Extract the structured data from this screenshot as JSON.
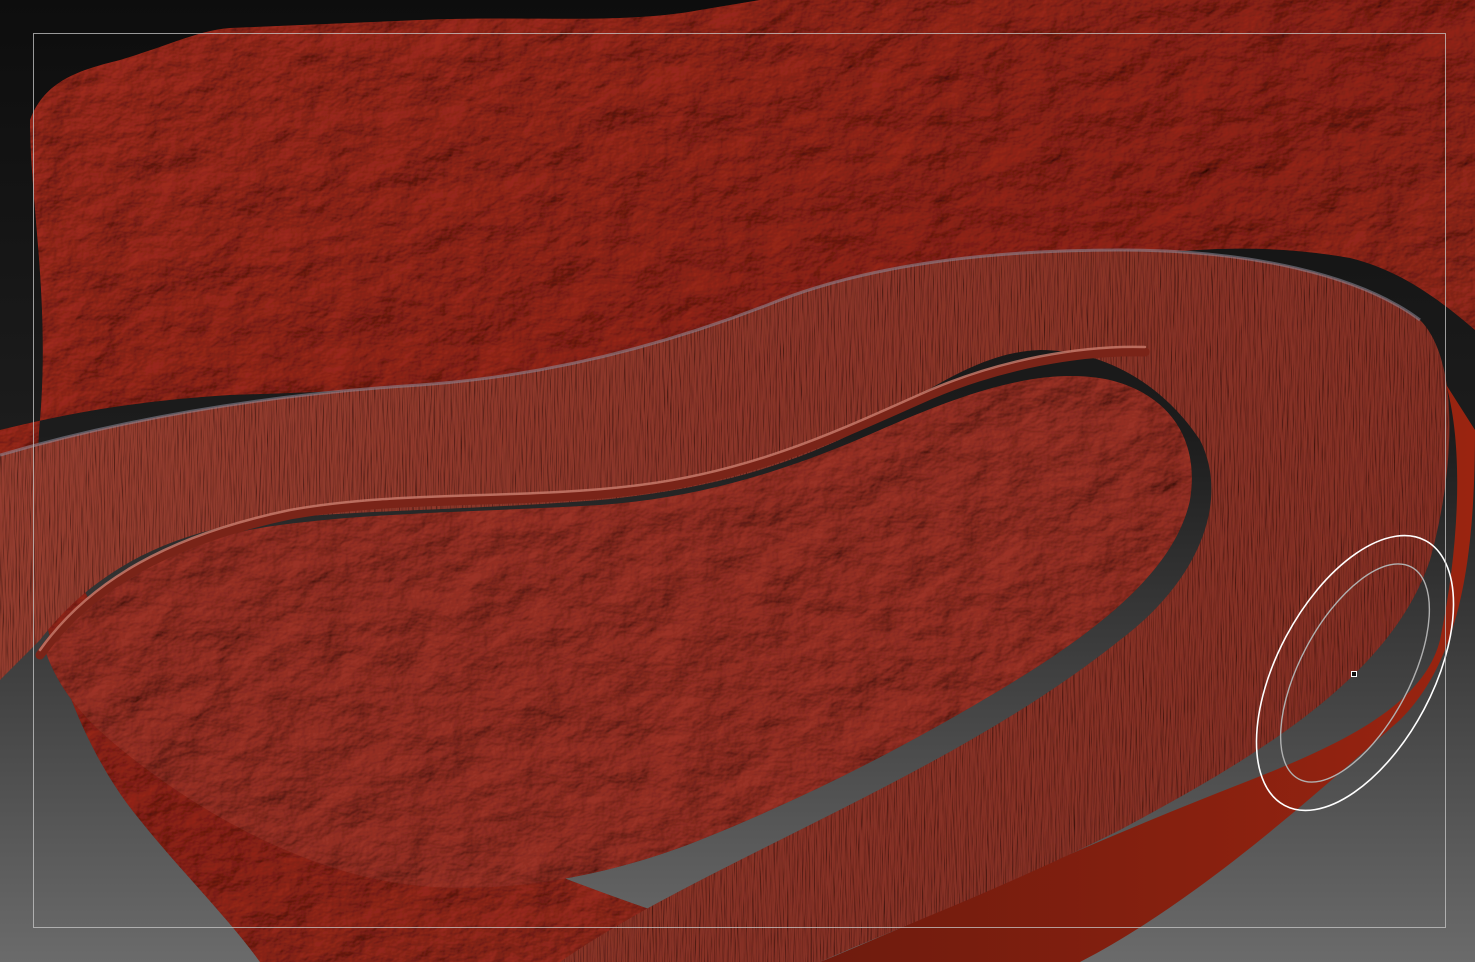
{
  "viewport": {
    "background_top": "#0d0d0d",
    "background_bottom": "#6b6b6b",
    "mesh_color": "#a8463d",
    "mesh_shadow": "#5c1a12",
    "mesh_highlight": "#d79483",
    "road_color": "#a65a50",
    "rim_color": "#8a1f0f",
    "frame_color": "#c8c8c8",
    "brush_ring_color": "#ffffff"
  },
  "scene": {
    "terrain": "terrain-mesh",
    "road": "road-surface",
    "curb": "road-curb",
    "base": "mesh-base-edge"
  },
  "brush": {
    "outer_ring": "brush-outer-ring",
    "inner_ring": "brush-inner-ring",
    "cursor": "brush-cursor"
  }
}
